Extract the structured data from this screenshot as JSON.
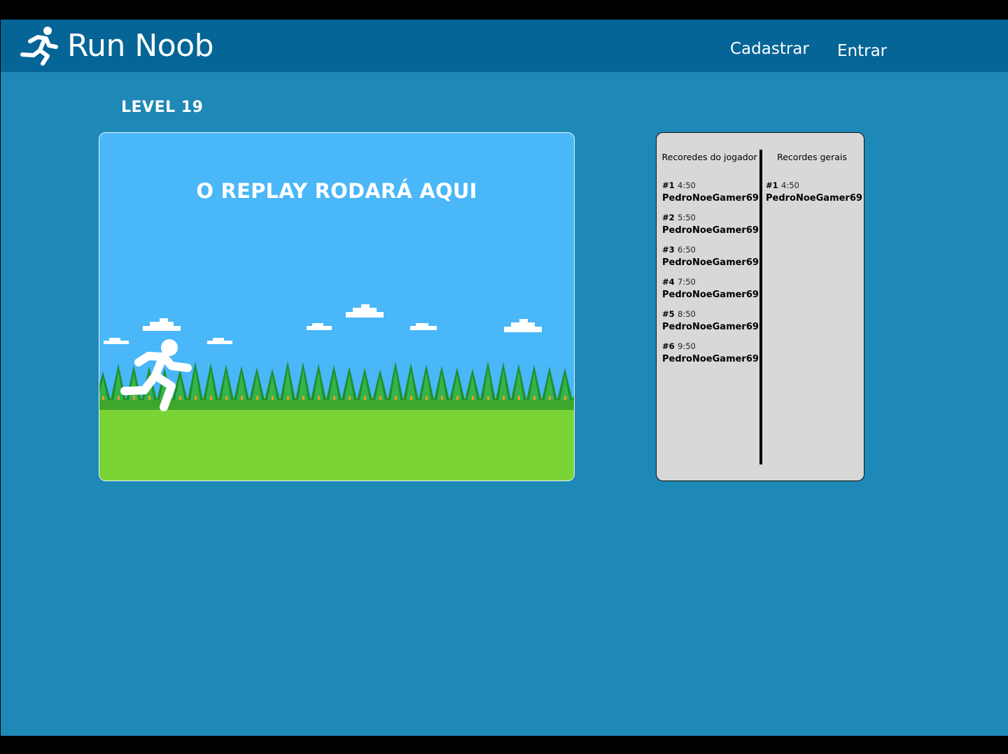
{
  "app": {
    "brand": "Run Noob"
  },
  "nav": {
    "register_label": "Cadastrar",
    "login_label": "Entrar"
  },
  "level": {
    "title": "LEVEL 19"
  },
  "replay": {
    "caption": "O REPLAY RODARÁ AQUI"
  },
  "records": {
    "player_title": "Recoredes do jogador",
    "global_title": "Recordes gerais",
    "player": [
      {
        "rank": "#1",
        "time": "4:50",
        "name": "PedroNoeGamer69"
      },
      {
        "rank": "#2",
        "time": "5:50",
        "name": "PedroNoeGamer69"
      },
      {
        "rank": "#3",
        "time": "6:50",
        "name": "PedroNoeGamer69"
      },
      {
        "rank": "#4",
        "time": "7:50",
        "name": "PedroNoeGamer69"
      },
      {
        "rank": "#5",
        "time": "8:50",
        "name": "PedroNoeGamer69"
      },
      {
        "rank": "#6",
        "time": "9:50",
        "name": "PedroNoeGamer69"
      }
    ],
    "global": [
      {
        "rank": "#1",
        "time": "4:50",
        "name": "PedroNoeGamer69"
      }
    ]
  },
  "icons": {
    "logo": "running-person-icon",
    "replay_runner": "running-person-icon"
  },
  "colors": {
    "background": "#1e88b6",
    "header": "#056597",
    "sky": "#49b7f8",
    "grass": "#7bd436",
    "trees": "#1f8f2e",
    "panel": "#d8d8d8"
  }
}
